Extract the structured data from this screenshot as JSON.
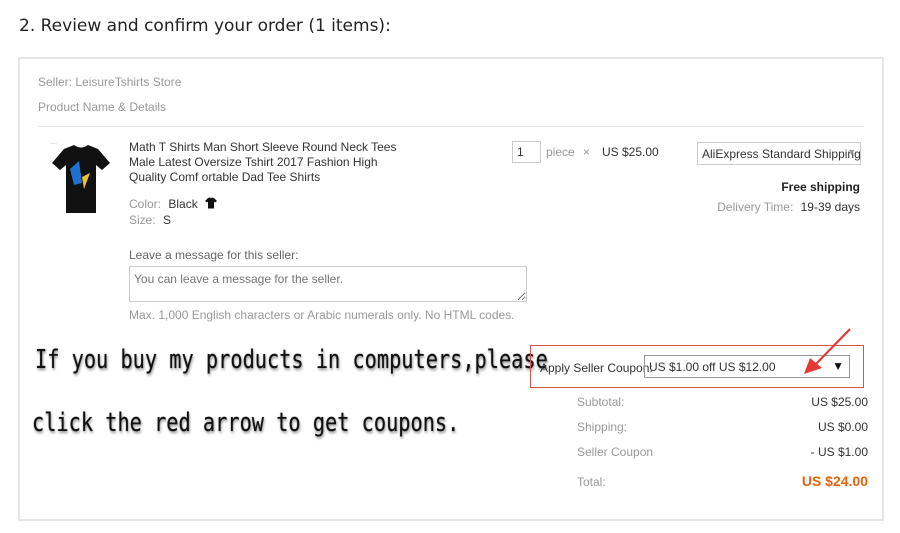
{
  "section_title": "2. Review and confirm your order (1 items):",
  "seller": "Seller: LeisureTshirts Store",
  "product_name_header": "Product Name & Details",
  "product": {
    "title": "Math T Shirts Man Short Sleeve Round Neck Tees Male Latest Oversize Tshirt 2017 Fashion High Quality Comf ortable Dad Tee Shirts",
    "color_key": "Color:",
    "color_value": "Black",
    "size_key": "Size:",
    "size_value": "S",
    "quantity": "1",
    "unit": "piece",
    "times": "×",
    "price": "US $25.00"
  },
  "shipping": {
    "method": "AliExpress Standard Shipping",
    "free_label": "Free shipping",
    "delivery_key": "Delivery Time:",
    "delivery_value": "19-39 days"
  },
  "message": {
    "label": "Leave a message for this seller:",
    "placeholder": "You can leave a message for the seller.",
    "note": "Max. 1,000 English characters or Arabic numerals only. No HTML codes."
  },
  "overlay": {
    "line1": "If you buy my products in computers,please",
    "line2": "click the red arrow to get coupons."
  },
  "coupon": {
    "label": "Apply Seller Coupon:",
    "selected": "US $1.00 off US $12.00"
  },
  "summary": {
    "subtotal_key": "Subtotal:",
    "subtotal_value": "US $25.00",
    "shipping_key": "Shipping:",
    "shipping_value": "US $0.00",
    "coupon_key": "Seller Coupon",
    "coupon_value": "- US $1.00",
    "total_key": "Total:",
    "total_value": "US $24.00"
  },
  "colors": {
    "accent_total": "#e8620c",
    "coupon_border": "#d9534f",
    "arrow": "#e53935"
  },
  "icons": [
    "tshirt-icon",
    "caret-down-icon",
    "red-arrow-icon"
  ]
}
